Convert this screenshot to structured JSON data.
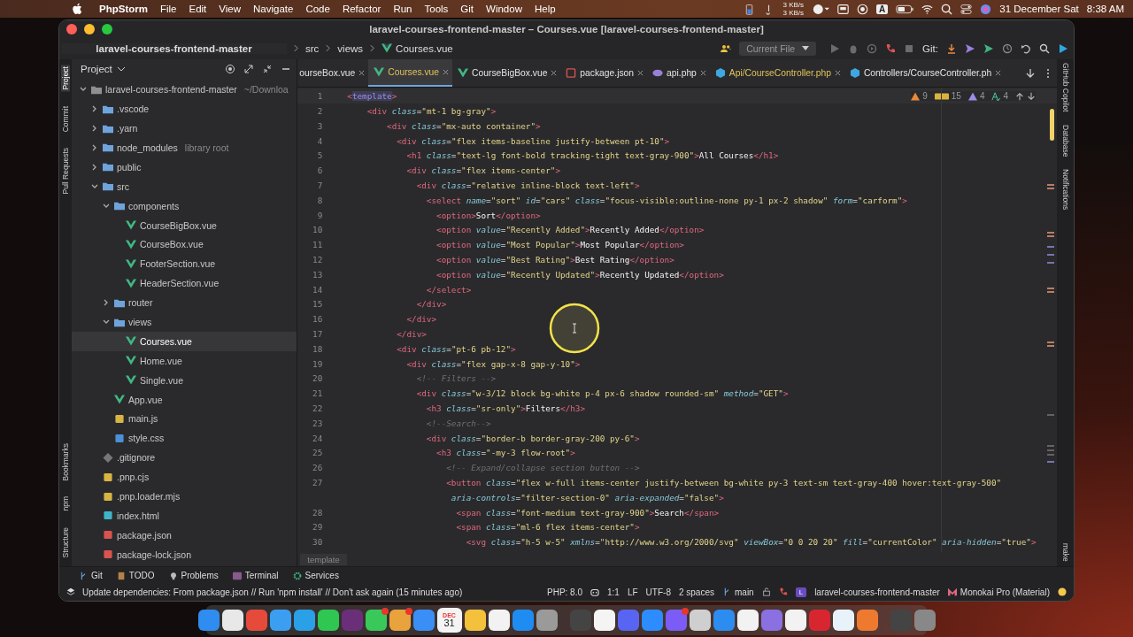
{
  "menubar": {
    "app": "PhpStorm",
    "menus": [
      "File",
      "Edit",
      "View",
      "Navigate",
      "Code",
      "Refactor",
      "Run",
      "Tools",
      "Git",
      "Window",
      "Help"
    ],
    "net_up": "3 KB/s",
    "net_down": "3 KB/s",
    "input_source": "A",
    "date": "31 December Sat",
    "time": "8:38 AM"
  },
  "window": {
    "title": "laravel-courses-frontend-master – Courses.vue [laravel-courses-frontend-master]"
  },
  "breadcrumb": [
    {
      "text": "laravel-courses-frontend-master",
      "kind": "project"
    },
    {
      "text": "src",
      "kind": "folder"
    },
    {
      "text": "views",
      "kind": "folder"
    },
    {
      "text": "Courses.vue",
      "kind": "vue"
    }
  ],
  "toolbar": {
    "run_config": "Current File",
    "git_label": "Git:"
  },
  "left_strip": {
    "top": [
      {
        "label": "Project",
        "selected": true
      },
      {
        "label": "Commit",
        "selected": false
      },
      {
        "label": "Pull Requests",
        "selected": false
      }
    ],
    "bottom": [
      {
        "label": "Bookmarks",
        "selected": false
      },
      {
        "label": "npm",
        "selected": false
      },
      {
        "label": "Structure",
        "selected": false
      }
    ]
  },
  "right_strip": {
    "top": [
      "GitHub Copilot",
      "Database",
      "Notifications"
    ],
    "bottom": [
      "make"
    ]
  },
  "project": {
    "title": "Project",
    "tree": [
      {
        "name": "laravel-courses-frontend-master",
        "hint": "~/Downloa",
        "kind": "folder",
        "expanded": true,
        "selected": false,
        "children": [
          {
            "name": ".vscode",
            "kind": "folder",
            "expanded": false,
            "selected": false
          },
          {
            "name": ".yarn",
            "kind": "folder",
            "expanded": false,
            "selected": false
          },
          {
            "name": "node_modules",
            "hint": "library root",
            "kind": "folder",
            "expanded": false,
            "selected": false
          },
          {
            "name": "public",
            "kind": "folder",
            "expanded": false,
            "selected": false
          },
          {
            "name": "src",
            "kind": "folder",
            "expanded": true,
            "selected": false,
            "children": [
              {
                "name": "components",
                "kind": "folder",
                "expanded": true,
                "selected": false,
                "children": [
                  {
                    "name": "CourseBigBox.vue",
                    "kind": "vue",
                    "selected": false
                  },
                  {
                    "name": "CourseBox.vue",
                    "kind": "vue",
                    "selected": false
                  },
                  {
                    "name": "FooterSection.vue",
                    "kind": "vue",
                    "selected": false
                  },
                  {
                    "name": "HeaderSection.vue",
                    "kind": "vue",
                    "selected": false
                  }
                ]
              },
              {
                "name": "router",
                "kind": "folder",
                "expanded": false,
                "selected": false
              },
              {
                "name": "views",
                "kind": "folder",
                "expanded": true,
                "selected": false,
                "children": [
                  {
                    "name": "Courses.vue",
                    "kind": "vue",
                    "selected": true
                  },
                  {
                    "name": "Home.vue",
                    "kind": "vue",
                    "selected": false
                  },
                  {
                    "name": "Single.vue",
                    "kind": "vue",
                    "selected": false
                  }
                ]
              },
              {
                "name": "App.vue",
                "kind": "vue",
                "selected": false
              },
              {
                "name": "main.js",
                "kind": "js",
                "selected": false
              },
              {
                "name": "style.css",
                "kind": "css",
                "selected": false
              }
            ]
          },
          {
            "name": ".gitignore",
            "kind": "git",
            "selected": false
          },
          {
            "name": ".pnp.cjs",
            "kind": "js",
            "selected": false
          },
          {
            "name": ".pnp.loader.mjs",
            "kind": "js",
            "selected": false
          },
          {
            "name": "index.html",
            "kind": "html",
            "selected": false
          },
          {
            "name": "package.json",
            "kind": "json",
            "selected": false
          },
          {
            "name": "package-lock.json",
            "kind": "lock",
            "selected": false
          }
        ]
      }
    ]
  },
  "tabs": [
    {
      "label": "ourseBox.vue",
      "kind": "plain",
      "selected": false,
      "modified": false
    },
    {
      "label": "Courses.vue",
      "kind": "vue",
      "selected": true,
      "modified": true
    },
    {
      "label": "CourseBigBox.vue",
      "kind": "vue",
      "selected": false,
      "modified": false
    },
    {
      "label": "package.json",
      "kind": "json",
      "selected": false,
      "modified": false
    },
    {
      "label": "api.php",
      "kind": "php",
      "selected": false,
      "modified": false
    },
    {
      "label": "Api/CourseController.php",
      "kind": "class",
      "selected": false,
      "modified": true
    },
    {
      "label": "Controllers/CourseController.ph",
      "kind": "class",
      "selected": false,
      "modified": false
    }
  ],
  "inspections": {
    "warnings": "9",
    "typos": "15",
    "weak_warnings": "4",
    "grammar": "4"
  },
  "code": [
    {
      "num": "1",
      "tokens": [
        {
          "kind": "tag",
          "text": "<"
        },
        {
          "kind": "match",
          "text": "template"
        },
        {
          "kind": "tag",
          "text": ">"
        }
      ]
    },
    {
      "num": "2",
      "tokens": [
        {
          "kind": "tag",
          "text": "    <div"
        },
        {
          "kind": "attr",
          "text": " class"
        },
        {
          "kind": "punct",
          "text": "="
        },
        {
          "kind": "str",
          "text": "\"mt-1 bg-gray\""
        },
        {
          "kind": "tag",
          "text": ">"
        }
      ]
    },
    {
      "num": "3",
      "tokens": [
        {
          "kind": "tag",
          "text": "        <div"
        },
        {
          "kind": "attr",
          "text": " class"
        },
        {
          "kind": "punct",
          "text": "="
        },
        {
          "kind": "str",
          "text": "\"mx-auto container\""
        },
        {
          "kind": "tag",
          "text": ">"
        }
      ]
    },
    {
      "num": "4",
      "tokens": [
        {
          "kind": "tag",
          "text": "          <div"
        },
        {
          "kind": "attr",
          "text": " class"
        },
        {
          "kind": "punct",
          "text": "="
        },
        {
          "kind": "str",
          "text": "\"flex items-baseline justify-between pt-10\""
        },
        {
          "kind": "tag",
          "text": ">"
        }
      ]
    },
    {
      "num": "5",
      "tokens": [
        {
          "kind": "tag",
          "text": "            <h1"
        },
        {
          "kind": "attr",
          "text": " class"
        },
        {
          "kind": "punct",
          "text": "="
        },
        {
          "kind": "str",
          "text": "\"text-lg font-bold tracking-tight text-gray-900\""
        },
        {
          "kind": "tag",
          "text": ">"
        },
        {
          "kind": "text",
          "text": "All Courses"
        },
        {
          "kind": "tag",
          "text": "</h1>"
        }
      ]
    },
    {
      "num": "6",
      "tokens": [
        {
          "kind": "tag",
          "text": "            <div"
        },
        {
          "kind": "attr",
          "text": " class"
        },
        {
          "kind": "punct",
          "text": "="
        },
        {
          "kind": "str",
          "text": "\"flex items-center\""
        },
        {
          "kind": "tag",
          "text": ">"
        }
      ]
    },
    {
      "num": "7",
      "tokens": [
        {
          "kind": "tag",
          "text": "              <div"
        },
        {
          "kind": "attr",
          "text": " class"
        },
        {
          "kind": "punct",
          "text": "="
        },
        {
          "kind": "str",
          "text": "\"relative inline-block text-left\""
        },
        {
          "kind": "tag",
          "text": ">"
        }
      ]
    },
    {
      "num": "8",
      "tokens": [
        {
          "kind": "tag",
          "text": "                <select"
        },
        {
          "kind": "attr",
          "text": " name"
        },
        {
          "kind": "punct",
          "text": "="
        },
        {
          "kind": "str",
          "text": "\"sort\""
        },
        {
          "kind": "attr",
          "text": " id"
        },
        {
          "kind": "punct",
          "text": "="
        },
        {
          "kind": "str",
          "text": "\"cars\""
        },
        {
          "kind": "attr",
          "text": " class"
        },
        {
          "kind": "punct",
          "text": "="
        },
        {
          "kind": "str",
          "text": "\"focus-visible:outline-none py-1 px-2 shadow\""
        },
        {
          "kind": "attr",
          "text": " form"
        },
        {
          "kind": "punct",
          "text": "="
        },
        {
          "kind": "str",
          "text": "\"carform\""
        },
        {
          "kind": "tag",
          "text": ">"
        }
      ]
    },
    {
      "num": "9",
      "tokens": [
        {
          "kind": "tag",
          "text": "                  <option>"
        },
        {
          "kind": "text",
          "text": "Sort"
        },
        {
          "kind": "tag",
          "text": "</option>"
        }
      ]
    },
    {
      "num": "10",
      "tokens": [
        {
          "kind": "tag",
          "text": "                  <option"
        },
        {
          "kind": "attr",
          "text": " value"
        },
        {
          "kind": "punct",
          "text": "="
        },
        {
          "kind": "str",
          "text": "\"Recently Added\""
        },
        {
          "kind": "tag",
          "text": ">"
        },
        {
          "kind": "text",
          "text": "Recently Added"
        },
        {
          "kind": "tag",
          "text": "</option>"
        }
      ]
    },
    {
      "num": "11",
      "tokens": [
        {
          "kind": "tag",
          "text": "                  <option"
        },
        {
          "kind": "attr",
          "text": " value"
        },
        {
          "kind": "punct",
          "text": "="
        },
        {
          "kind": "str",
          "text": "\"Most Popular\""
        },
        {
          "kind": "tag",
          "text": ">"
        },
        {
          "kind": "text",
          "text": "Most Popular"
        },
        {
          "kind": "tag",
          "text": "</option>"
        }
      ]
    },
    {
      "num": "12",
      "tokens": [
        {
          "kind": "tag",
          "text": "                  <option"
        },
        {
          "kind": "attr",
          "text": " value"
        },
        {
          "kind": "punct",
          "text": "="
        },
        {
          "kind": "str",
          "text": "\"Best Rating\""
        },
        {
          "kind": "tag",
          "text": ">"
        },
        {
          "kind": "text",
          "text": "Best Rating"
        },
        {
          "kind": "tag",
          "text": "</option>"
        }
      ]
    },
    {
      "num": "13",
      "tokens": [
        {
          "kind": "tag",
          "text": "                  <option"
        },
        {
          "kind": "attr",
          "text": " value"
        },
        {
          "kind": "punct",
          "text": "="
        },
        {
          "kind": "str",
          "text": "\"Recently Updated\""
        },
        {
          "kind": "tag",
          "text": ">"
        },
        {
          "kind": "text",
          "text": "Recently Updated"
        },
        {
          "kind": "tag",
          "text": "</option>"
        }
      ]
    },
    {
      "num": "14",
      "tokens": [
        {
          "kind": "tag",
          "text": "                </select>"
        }
      ]
    },
    {
      "num": "15",
      "tokens": [
        {
          "kind": "tag",
          "text": "              </div>"
        }
      ]
    },
    {
      "num": "16",
      "tokens": [
        {
          "kind": "tag",
          "text": "            </div>"
        }
      ]
    },
    {
      "num": "17",
      "tokens": [
        {
          "kind": "tag",
          "text": "          </div>"
        }
      ]
    },
    {
      "num": "18",
      "tokens": [
        {
          "kind": "tag",
          "text": "          <div"
        },
        {
          "kind": "attr",
          "text": " class"
        },
        {
          "kind": "punct",
          "text": "="
        },
        {
          "kind": "str",
          "text": "\"pt-6 pb-12\""
        },
        {
          "kind": "tag",
          "text": ">"
        }
      ]
    },
    {
      "num": "19",
      "tokens": [
        {
          "kind": "tag",
          "text": "            <div"
        },
        {
          "kind": "attr",
          "text": " class"
        },
        {
          "kind": "punct",
          "text": "="
        },
        {
          "kind": "str",
          "text": "\"flex gap-x-8 gap-y-10\""
        },
        {
          "kind": "tag",
          "text": ">"
        }
      ]
    },
    {
      "num": "20",
      "tokens": [
        {
          "kind": "comment",
          "text": "              <!-- Filters -->"
        }
      ]
    },
    {
      "num": "21",
      "tokens": [
        {
          "kind": "tag",
          "text": "              <div"
        },
        {
          "kind": "attr",
          "text": " class"
        },
        {
          "kind": "punct",
          "text": "="
        },
        {
          "kind": "str",
          "text": "\"w-3/12 block bg-white p-4 px-6 shadow rounded-sm\""
        },
        {
          "kind": "attr",
          "text": " method"
        },
        {
          "kind": "punct",
          "text": "="
        },
        {
          "kind": "str",
          "text": "\"GET\""
        },
        {
          "kind": "tag",
          "text": ">"
        }
      ]
    },
    {
      "num": "22",
      "tokens": [
        {
          "kind": "tag",
          "text": "                <h3"
        },
        {
          "kind": "attr",
          "text": " class"
        },
        {
          "kind": "punct",
          "text": "="
        },
        {
          "kind": "str",
          "text": "\"sr-only\""
        },
        {
          "kind": "tag",
          "text": ">"
        },
        {
          "kind": "text",
          "text": "Filters"
        },
        {
          "kind": "tag",
          "text": "</h3>"
        }
      ]
    },
    {
      "num": "23",
      "tokens": [
        {
          "kind": "comment",
          "text": "                <!--Search-->"
        }
      ]
    },
    {
      "num": "24",
      "tokens": [
        {
          "kind": "tag",
          "text": "                <div"
        },
        {
          "kind": "attr",
          "text": " class"
        },
        {
          "kind": "punct",
          "text": "="
        },
        {
          "kind": "str",
          "text": "\"border-b border-gray-200 py-6\""
        },
        {
          "kind": "tag",
          "text": ">"
        }
      ]
    },
    {
      "num": "25",
      "tokens": [
        {
          "kind": "tag",
          "text": "                  <h3"
        },
        {
          "kind": "attr",
          "text": " class"
        },
        {
          "kind": "punct",
          "text": "="
        },
        {
          "kind": "str",
          "text": "\"-my-3 flow-root\""
        },
        {
          "kind": "tag",
          "text": ">"
        }
      ]
    },
    {
      "num": "26",
      "tokens": [
        {
          "kind": "comment",
          "text": "                    <!-- Expand/collapse section button -->"
        }
      ]
    },
    {
      "num": "27",
      "tokens": [
        {
          "kind": "tag",
          "text": "                    <button"
        },
        {
          "kind": "attr",
          "text": " class"
        },
        {
          "kind": "punct",
          "text": "="
        },
        {
          "kind": "str",
          "text": "\"flex w-full items-center justify-between bg-white py-3 text-sm text-gray-400 hover:text-gray-500\""
        }
      ]
    },
    {
      "tokens": [
        {
          "kind": "attr",
          "text": "                     aria-controls"
        },
        {
          "kind": "punct",
          "text": "="
        },
        {
          "kind": "str",
          "text": "\"filter-section-0\""
        },
        {
          "kind": "attr",
          "text": " aria-expanded"
        },
        {
          "kind": "punct",
          "text": "="
        },
        {
          "kind": "str",
          "text": "\"false\""
        },
        {
          "kind": "tag",
          "text": ">"
        }
      ]
    },
    {
      "num": "28",
      "tokens": [
        {
          "kind": "tag",
          "text": "                      <span"
        },
        {
          "kind": "attr",
          "text": " class"
        },
        {
          "kind": "punct",
          "text": "="
        },
        {
          "kind": "str",
          "text": "\"font-medium text-gray-900\""
        },
        {
          "kind": "tag",
          "text": ">"
        },
        {
          "kind": "text",
          "text": "Search"
        },
        {
          "kind": "tag",
          "text": "</span>"
        }
      ]
    },
    {
      "num": "29",
      "tokens": [
        {
          "kind": "tag",
          "text": "                      <span"
        },
        {
          "kind": "attr",
          "text": " class"
        },
        {
          "kind": "punct",
          "text": "="
        },
        {
          "kind": "str",
          "text": "\"ml-6 flex items-center\""
        },
        {
          "kind": "tag",
          "text": ">"
        }
      ]
    },
    {
      "num": "30",
      "tokens": [
        {
          "kind": "tag",
          "text": "                        <svg"
        },
        {
          "kind": "attr",
          "text": " class"
        },
        {
          "kind": "punct",
          "text": "="
        },
        {
          "kind": "str",
          "text": "\"h-5 w-5\""
        },
        {
          "kind": "attr",
          "text": " xmlns"
        },
        {
          "kind": "punct",
          "text": "="
        },
        {
          "kind": "str",
          "text": "\"http://www.w3.org/2000/svg\""
        },
        {
          "kind": "attr",
          "text": " viewBox"
        },
        {
          "kind": "punct",
          "text": "="
        },
        {
          "kind": "str",
          "text": "\"0 0 20 20\""
        },
        {
          "kind": "attr",
          "text": " fill"
        },
        {
          "kind": "punct",
          "text": "="
        },
        {
          "kind": "str",
          "text": "\"currentColor\""
        },
        {
          "kind": "attr",
          "text": " aria-hidden"
        },
        {
          "kind": "punct",
          "text": "="
        },
        {
          "kind": "str",
          "text": "\"true\""
        },
        {
          "kind": "tag",
          "text": ">"
        }
      ]
    }
  ],
  "editor_breadcrumb": "template",
  "tool_buttons": [
    {
      "label": "Git",
      "kind": "git"
    },
    {
      "label": "TODO",
      "kind": "todo"
    },
    {
      "label": "Problems",
      "kind": "problems"
    },
    {
      "label": "Terminal",
      "kind": "terminal"
    },
    {
      "label": "Services",
      "kind": "services"
    }
  ],
  "status": {
    "message": "Update dependencies: From package.json // Run 'npm install' // Don't ask again (15 minutes ago)",
    "php": "PHP: 8.0",
    "position": "1:1",
    "line_separator": "LF",
    "encoding": "UTF-8",
    "indent": "2 spaces",
    "branch": "main",
    "avatar": "L",
    "project": "laravel-courses-frontend-master",
    "theme": "Monokai Pro (Material)"
  },
  "dock": {
    "calendar_month": "DEC",
    "calendar_day": "31"
  }
}
